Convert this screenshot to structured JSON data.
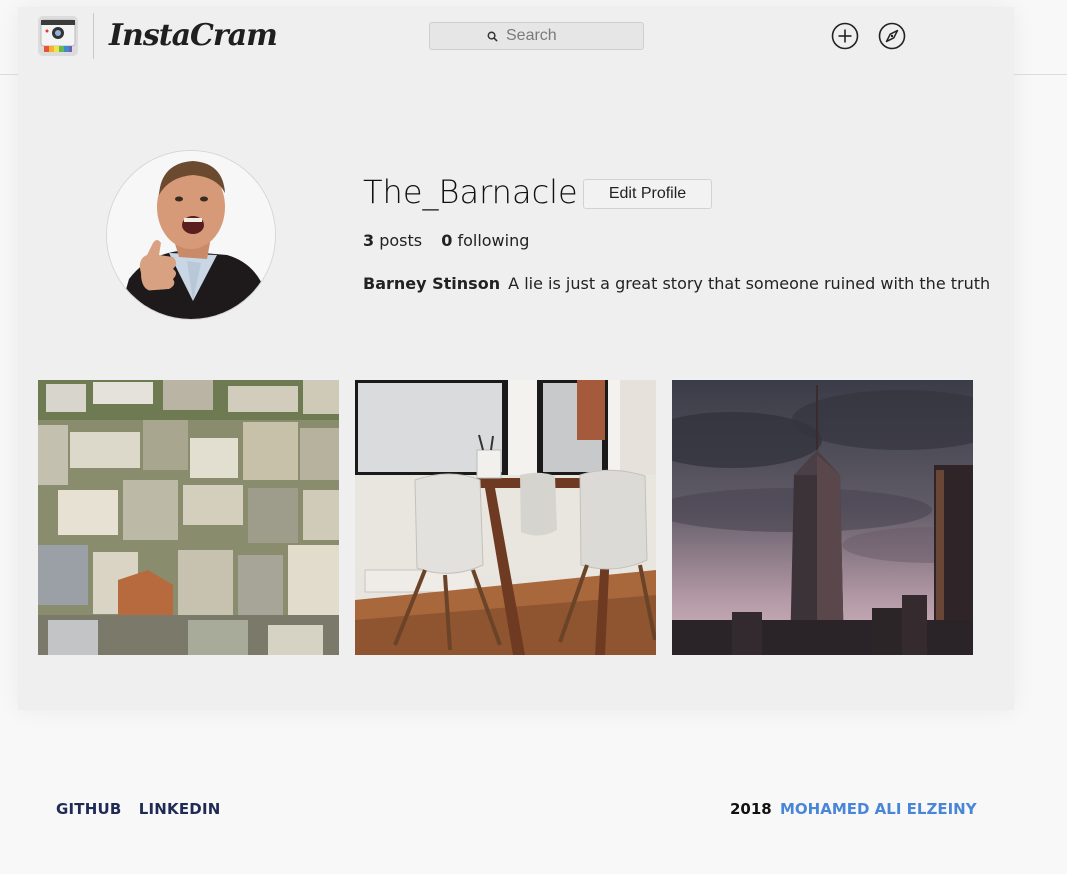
{
  "header": {
    "logo_text": "InstaCram",
    "search": {
      "placeholder": "Search",
      "value": ""
    },
    "nav": [
      {
        "icon": "plus-circle-icon"
      },
      {
        "icon": "compass-icon"
      }
    ]
  },
  "profile": {
    "username": "The_Barnacle",
    "edit_label": "Edit Profile",
    "stats": {
      "posts_count": "3",
      "posts_label": "posts",
      "following_count": "0",
      "following_label": "following"
    },
    "bio": {
      "full_name": "Barney Stinson",
      "text": "A lie is just a great story that someone ruined with the truth"
    }
  },
  "posts": [
    {
      "icon": "city-rooftops-photo"
    },
    {
      "icon": "dining-chairs-photo"
    },
    {
      "icon": "skyscraper-dusk-photo"
    }
  ],
  "footer": {
    "links": [
      "GITHUB",
      "LINKEDIN"
    ],
    "year": "2018",
    "author": "MOHAMED ALI ELZEINY"
  },
  "colors": {
    "panel_bg": "#efefef",
    "page_bg": "#f8f8f8",
    "footer_link": "#1f2a55",
    "author_link": "#4a86d8"
  }
}
